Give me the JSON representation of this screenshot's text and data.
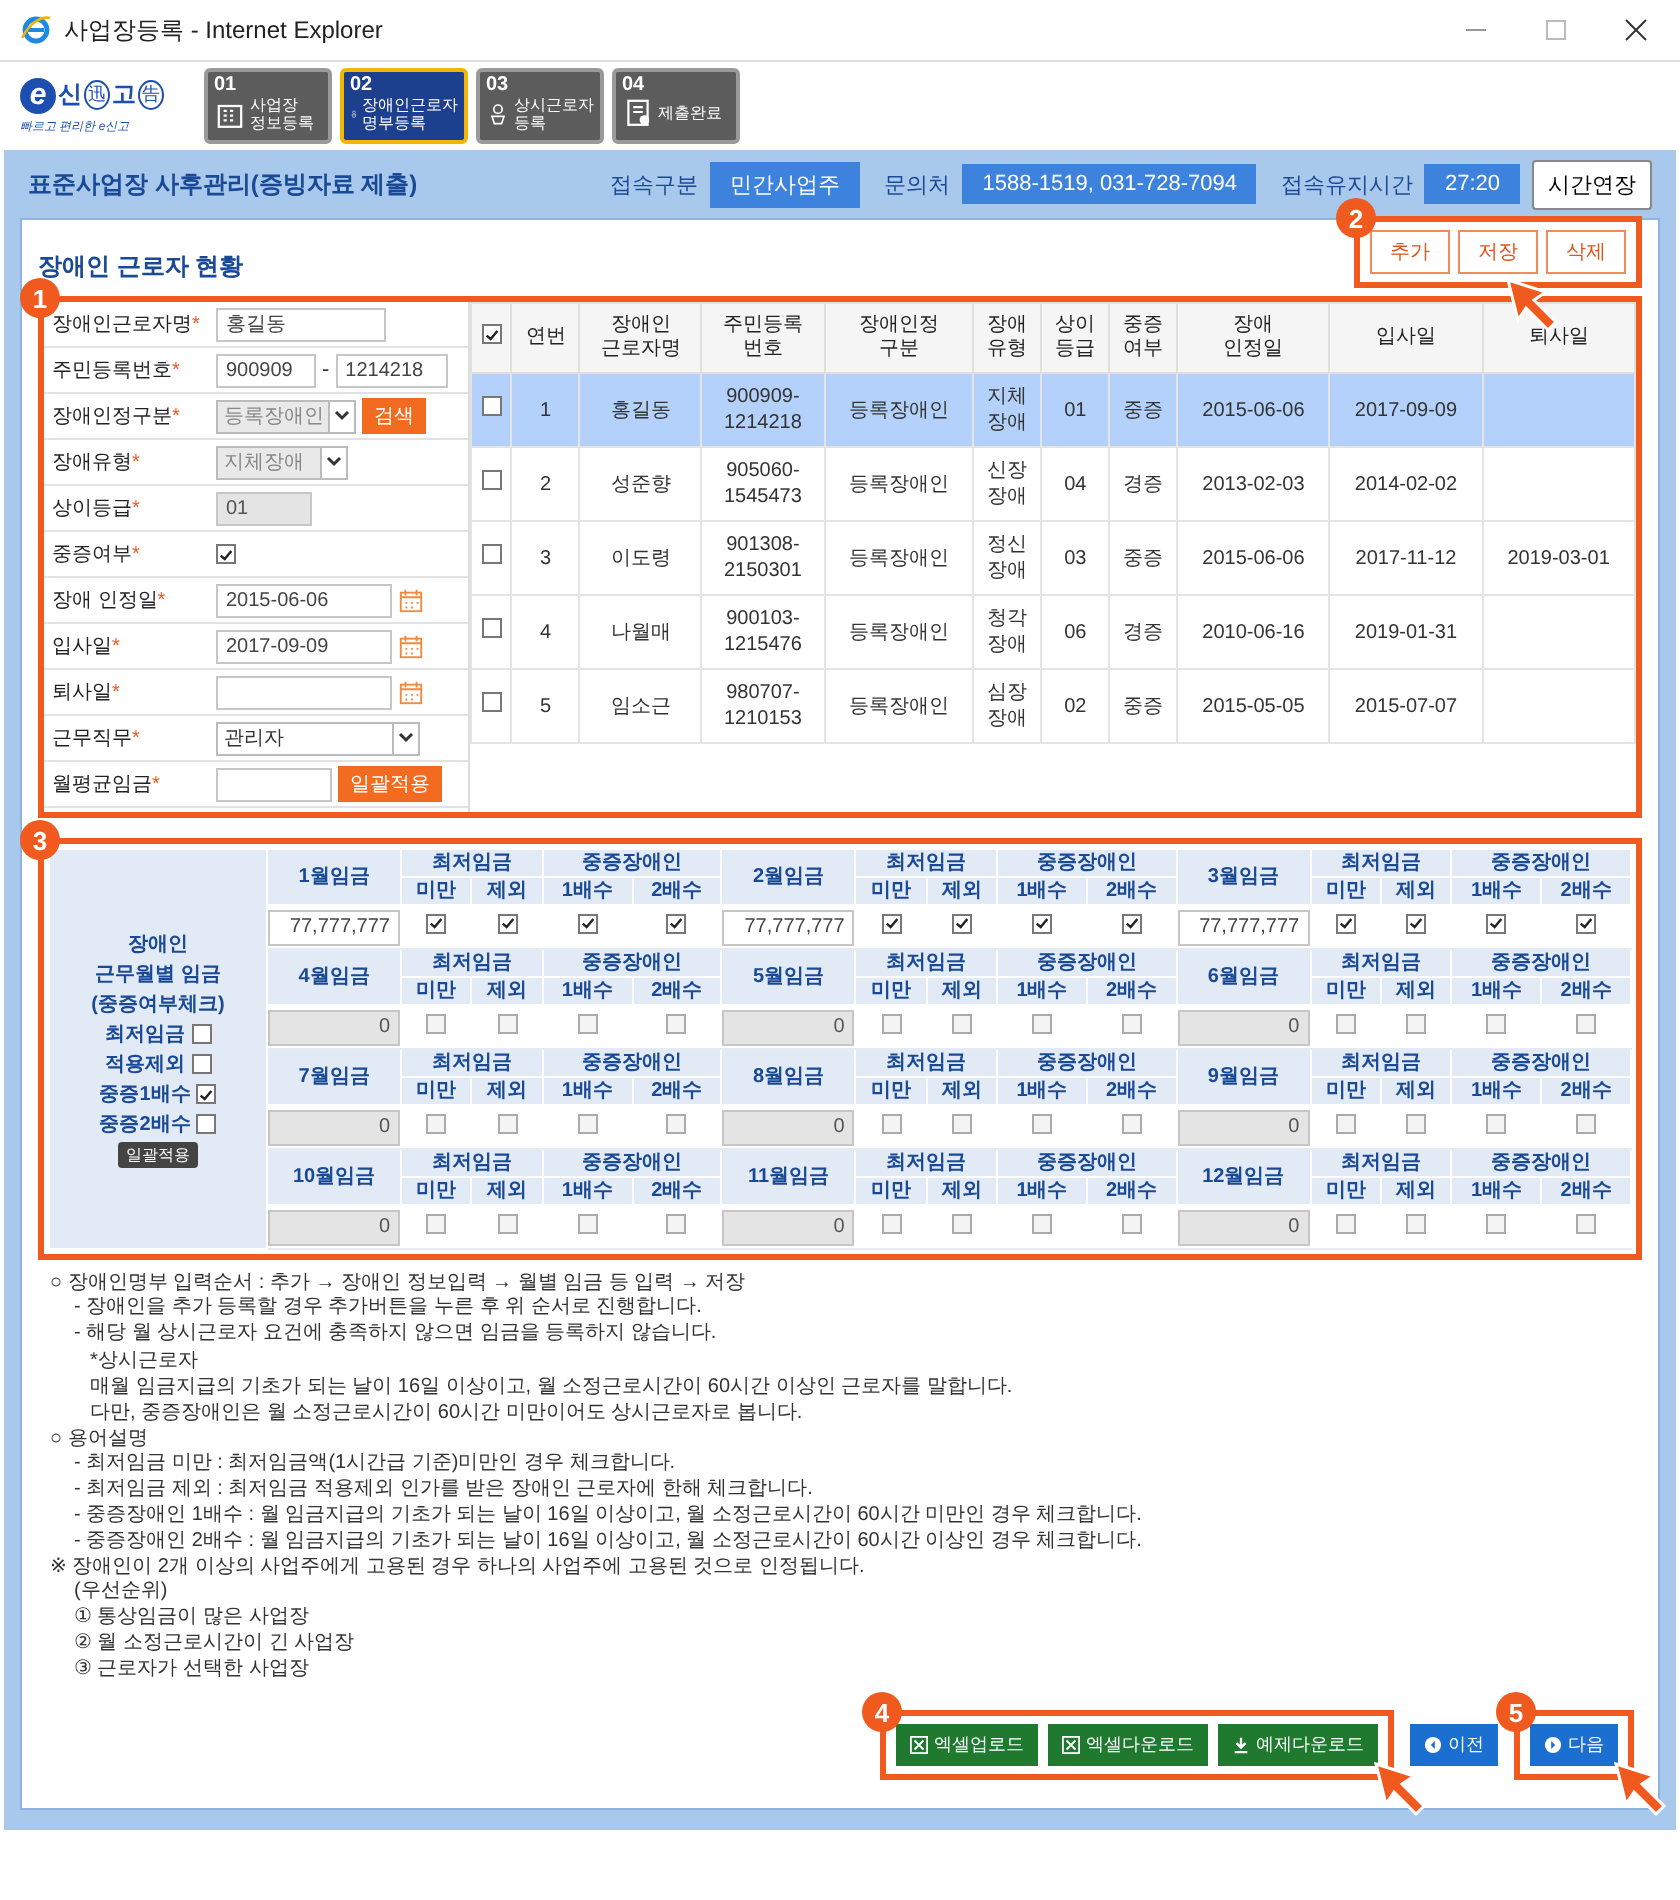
{
  "window": {
    "title": "사업장등록 - Internet Explorer"
  },
  "logo": {
    "letter": "e",
    "parts": [
      {
        "text": "신",
        "circled": false
      },
      {
        "text": "迅",
        "circled": true
      },
      {
        "text": "고",
        "circled": false
      },
      {
        "text": "告",
        "circled": true
      }
    ],
    "tagline": "빠르고 편리한 e신고"
  },
  "steps": [
    {
      "number": "01",
      "lines": [
        "사업장",
        "정보등록"
      ],
      "selected": false
    },
    {
      "number": "02",
      "lines": [
        "장애인근로자",
        "명부등록"
      ],
      "selected": true
    },
    {
      "number": "03",
      "lines": [
        "상시근로자",
        "등록"
      ],
      "selected": false
    },
    {
      "number": "04",
      "lines": [
        "제출완료"
      ],
      "selected": false
    }
  ],
  "header_bar": {
    "title": "표준사업장 사후관리(증빙자료 제출)",
    "info": [
      {
        "label": "접속구분",
        "value": "민간사업주"
      },
      {
        "label": "문의처",
        "value": "1588-1519, 031-728-7094"
      },
      {
        "label": "접속유지시간",
        "value": "27:20"
      }
    ],
    "button": "시간연장"
  },
  "section": {
    "title": "장애인 근로자 현황",
    "actions": {
      "callout": "2",
      "buttons": [
        {
          "label": "추가"
        },
        {
          "label": "저장",
          "pointed": true
        },
        {
          "label": "삭제"
        }
      ]
    }
  },
  "worker_panel": {
    "callout": "1",
    "form": [
      {
        "kind": "text",
        "label": "장애인근로자명",
        "required": "*",
        "value": "홍길동",
        "disabled": false
      },
      {
        "kind": "ssn",
        "label": "주민등록번호",
        "required": "*",
        "value": "900909",
        "separator": "-",
        "value2": "1214218"
      },
      {
        "kind": "select",
        "label": "장애인정구분",
        "required": "*",
        "value": "등록장애인",
        "disabled": true,
        "button": "검색"
      },
      {
        "kind": "select",
        "label": "장애유형",
        "required": "*",
        "value": "지체장애",
        "disabled": true
      },
      {
        "kind": "text",
        "label": "상이등급",
        "required": "*",
        "value": "01",
        "disabled": true
      },
      {
        "kind": "checkbox",
        "label": "중증여부",
        "required": "*",
        "checked": true
      },
      {
        "kind": "date",
        "label": "장애 인정일",
        "required": "*",
        "value": "2015-06-06"
      },
      {
        "kind": "date",
        "label": "입사일",
        "required": "*",
        "value": "2017-09-09"
      },
      {
        "kind": "date",
        "label": "퇴사일",
        "required": "*"
      },
      {
        "kind": "select",
        "label": "근무직무",
        "required": "*",
        "value": "관리자",
        "disabled": false
      },
      {
        "kind": "text",
        "label": "월평균임금",
        "required": "*",
        "disabled": false,
        "button": "일괄적용"
      }
    ],
    "table": {
      "header_checked": true,
      "columns": [
        "연번",
        "장애인\n근로자명",
        "주민등록\n번호",
        "장애인정\n구분",
        "장애\n유형",
        "상이\n등급",
        "중증\n여부",
        "장애\n인정일",
        "입사일",
        "퇴사일"
      ],
      "rows": [
        {
          "selected": true,
          "checked": false,
          "cells": [
            "1",
            "홍길동",
            "900909-\n1214218",
            "등록장애인",
            "지체\n장애",
            "01",
            "중증",
            "2015-06-06",
            "2017-09-09",
            null
          ]
        },
        {
          "selected": false,
          "checked": false,
          "cells": [
            "2",
            "성준향",
            "905060-\n1545473",
            "등록장애인",
            "신장\n장애",
            "04",
            "경증",
            "2013-02-03",
            "2014-02-02",
            null
          ]
        },
        {
          "selected": false,
          "checked": false,
          "cells": [
            "3",
            "이도령",
            "901308-\n2150301",
            "등록장애인",
            "정신\n장애",
            "03",
            "중증",
            "2015-06-06",
            "2017-11-12",
            "2019-03-01"
          ]
        },
        {
          "selected": false,
          "checked": false,
          "cells": [
            "4",
            "나월매",
            "900103-\n1215476",
            "등록장애인",
            "청각\n장애",
            "06",
            "경증",
            "2010-06-16",
            "2019-01-31",
            null
          ]
        },
        {
          "selected": false,
          "checked": false,
          "cells": [
            "5",
            "임소근",
            "980707-\n1210153",
            "등록장애인",
            "심장\n장애",
            "02",
            "중증",
            "2015-05-05",
            "2015-07-07",
            null
          ]
        }
      ]
    }
  },
  "wages": {
    "callout": "3",
    "legend": {
      "lines": [
        "장애인",
        "근무월별 임금",
        "(중증여부체크)"
      ],
      "options": [
        {
          "label": "최저임금",
          "checked": false
        },
        {
          "label": "적용제외",
          "checked": false
        },
        {
          "label": "중증1배수",
          "checked": true
        },
        {
          "label": "중증2배수",
          "checked": false
        }
      ],
      "button": "일괄적용"
    },
    "months": [
      {
        "label": "1월임금",
        "groups": [
          {
            "title": "최저임금",
            "cols": [
              "미만",
              "제외"
            ]
          },
          {
            "title": "중증장애인",
            "cols": [
              "1배수",
              "2배수"
            ]
          }
        ],
        "wage": "77,777,777",
        "disabled": false,
        "checks": [
          true,
          true,
          true,
          true
        ]
      },
      {
        "label": "2월임금",
        "groups": [
          {
            "title": "최저임금",
            "cols": [
              "미만",
              "제외"
            ]
          },
          {
            "title": "중증장애인",
            "cols": [
              "1배수",
              "2배수"
            ]
          }
        ],
        "wage": "77,777,777",
        "disabled": false,
        "checks": [
          true,
          true,
          true,
          true
        ]
      },
      {
        "label": "3월임금",
        "groups": [
          {
            "title": "최저임금",
            "cols": [
              "미만",
              "제외"
            ]
          },
          {
            "title": "중증장애인",
            "cols": [
              "1배수",
              "2배수"
            ]
          }
        ],
        "wage": "77,777,777",
        "disabled": false,
        "checks": [
          true,
          true,
          true,
          true
        ]
      },
      {
        "label": "4월임금",
        "groups": [
          {
            "title": "최저임금",
            "cols": [
              "미만",
              "제외"
            ]
          },
          {
            "title": "중증장애인",
            "cols": [
              "1배수",
              "2배수"
            ]
          }
        ],
        "wage": "0",
        "disabled": true,
        "checks": [
          false,
          false,
          false,
          false
        ]
      },
      {
        "label": "5월임금",
        "groups": [
          {
            "title": "최저임금",
            "cols": [
              "미만",
              "제외"
            ]
          },
          {
            "title": "중증장애인",
            "cols": [
              "1배수",
              "2배수"
            ]
          }
        ],
        "wage": "0",
        "disabled": true,
        "checks": [
          false,
          false,
          false,
          false
        ]
      },
      {
        "label": "6월임금",
        "groups": [
          {
            "title": "최저임금",
            "cols": [
              "미만",
              "제외"
            ]
          },
          {
            "title": "중증장애인",
            "cols": [
              "1배수",
              "2배수"
            ]
          }
        ],
        "wage": "0",
        "disabled": true,
        "checks": [
          false,
          false,
          false,
          false
        ]
      },
      {
        "label": "7월임금",
        "groups": [
          {
            "title": "최저임금",
            "cols": [
              "미만",
              "제외"
            ]
          },
          {
            "title": "중증장애인",
            "cols": [
              "1배수",
              "2배수"
            ]
          }
        ],
        "wage": "0",
        "disabled": true,
        "checks": [
          false,
          false,
          false,
          false
        ]
      },
      {
        "label": "8월임금",
        "groups": [
          {
            "title": "최저임금",
            "cols": [
              "미만",
              "제외"
            ]
          },
          {
            "title": "중증장애인",
            "cols": [
              "1배수",
              "2배수"
            ]
          }
        ],
        "wage": "0",
        "disabled": true,
        "checks": [
          false,
          false,
          false,
          false
        ]
      },
      {
        "label": "9월임금",
        "groups": [
          {
            "title": "최저임금",
            "cols": [
              "미만",
              "제외"
            ]
          },
          {
            "title": "중증장애인",
            "cols": [
              "1배수",
              "2배수"
            ]
          }
        ],
        "wage": "0",
        "disabled": true,
        "checks": [
          false,
          false,
          false,
          false
        ]
      },
      {
        "label": "10월임금",
        "groups": [
          {
            "title": "최저임금",
            "cols": [
              "미만",
              "제외"
            ]
          },
          {
            "title": "중증장애인",
            "cols": [
              "1배수",
              "2배수"
            ]
          }
        ],
        "wage": "0",
        "disabled": true,
        "checks": [
          false,
          false,
          false,
          false
        ]
      },
      {
        "label": "11월임금",
        "groups": [
          {
            "title": "최저임금",
            "cols": [
              "미만",
              "제외"
            ]
          },
          {
            "title": "중증장애인",
            "cols": [
              "1배수",
              "2배수"
            ]
          }
        ],
        "wage": "0",
        "disabled": true,
        "checks": [
          false,
          false,
          false,
          false
        ]
      },
      {
        "label": "12월임금",
        "groups": [
          {
            "title": "최저임금",
            "cols": [
              "미만",
              "제외"
            ]
          },
          {
            "title": "중증장애인",
            "cols": [
              "1배수",
              "2배수"
            ]
          }
        ],
        "wage": "0",
        "disabled": true,
        "checks": [
          false,
          false,
          false,
          false
        ]
      }
    ]
  },
  "notes": [
    {
      "text": "○ 장애인명부 입력순서 : 추가 → 장애인 정보입력 → 월별 임금 등 입력 → 저장",
      "children": [
        {
          "text": "- 장애인을 추가 등록할 경우 추가버튼을 누른 후 위 순서로 진행합니다."
        },
        {
          "text": "- 해당 월 상시근로자 요건에 충족하지 않으면 임금을 등록하지 않습니다.",
          "children": [
            {
              "text": "*상시근로자"
            },
            {
              "text": "매월 임금지급의 기초가 되는 날이 16일 이상이고, 월 소정근로시간이 60시간 이상인 근로자를 말합니다."
            },
            {
              "text": "다만, 중증장애인은 월 소정근로시간이 60시간 미만이어도 상시근로자로 봅니다."
            }
          ]
        }
      ]
    },
    {
      "text": "○ 용어설명",
      "children": [
        {
          "text": "- 최저임금 미만 : 최저임금액(1시간급 기준)미만인 경우 체크합니다."
        },
        {
          "text": "- 최저임금 제외 : 최저임금 적용제외 인가를 받은 장애인 근로자에 한해 체크합니다."
        },
        {
          "text": "- 중증장애인 1배수 : 월 임금지급의 기초가 되는 날이 16일 이상이고, 월 소정근로시간이 60시간 미만인 경우 체크합니다."
        },
        {
          "text": "- 중증장애인 2배수 : 월 임금지급의 기초가 되는 날이 16일 이상이고, 월 소정근로시간이 60시간 이상인 경우 체크합니다."
        }
      ]
    },
    {
      "text": "※ 장애인이 2개 이상의 사업주에게 고용된 경우 하나의 사업주에 고용된 것으로 인정됩니다.",
      "children": [
        {
          "text": "(우선순위)"
        },
        {
          "text": "① 통상임금이 많은 사업장"
        },
        {
          "text": "② 월 소정근로시간이 긴 사업장"
        },
        {
          "text": "③ 근로자가 선택한 사업장"
        }
      ]
    }
  ],
  "footer": {
    "groups": [
      {
        "callout": "4",
        "buttons": [
          {
            "kind": "excel",
            "label": "엑셀업로드"
          },
          {
            "kind": "excel",
            "label": "엑셀다운로드"
          },
          {
            "kind": "download",
            "label": "예제다운로드",
            "pointed": true
          }
        ]
      },
      {
        "buttons": [
          {
            "kind": "prev",
            "label": "이전"
          }
        ]
      },
      {
        "callout": "5",
        "buttons": [
          {
            "kind": "next",
            "label": "다음",
            "pointed": true
          }
        ]
      }
    ]
  }
}
